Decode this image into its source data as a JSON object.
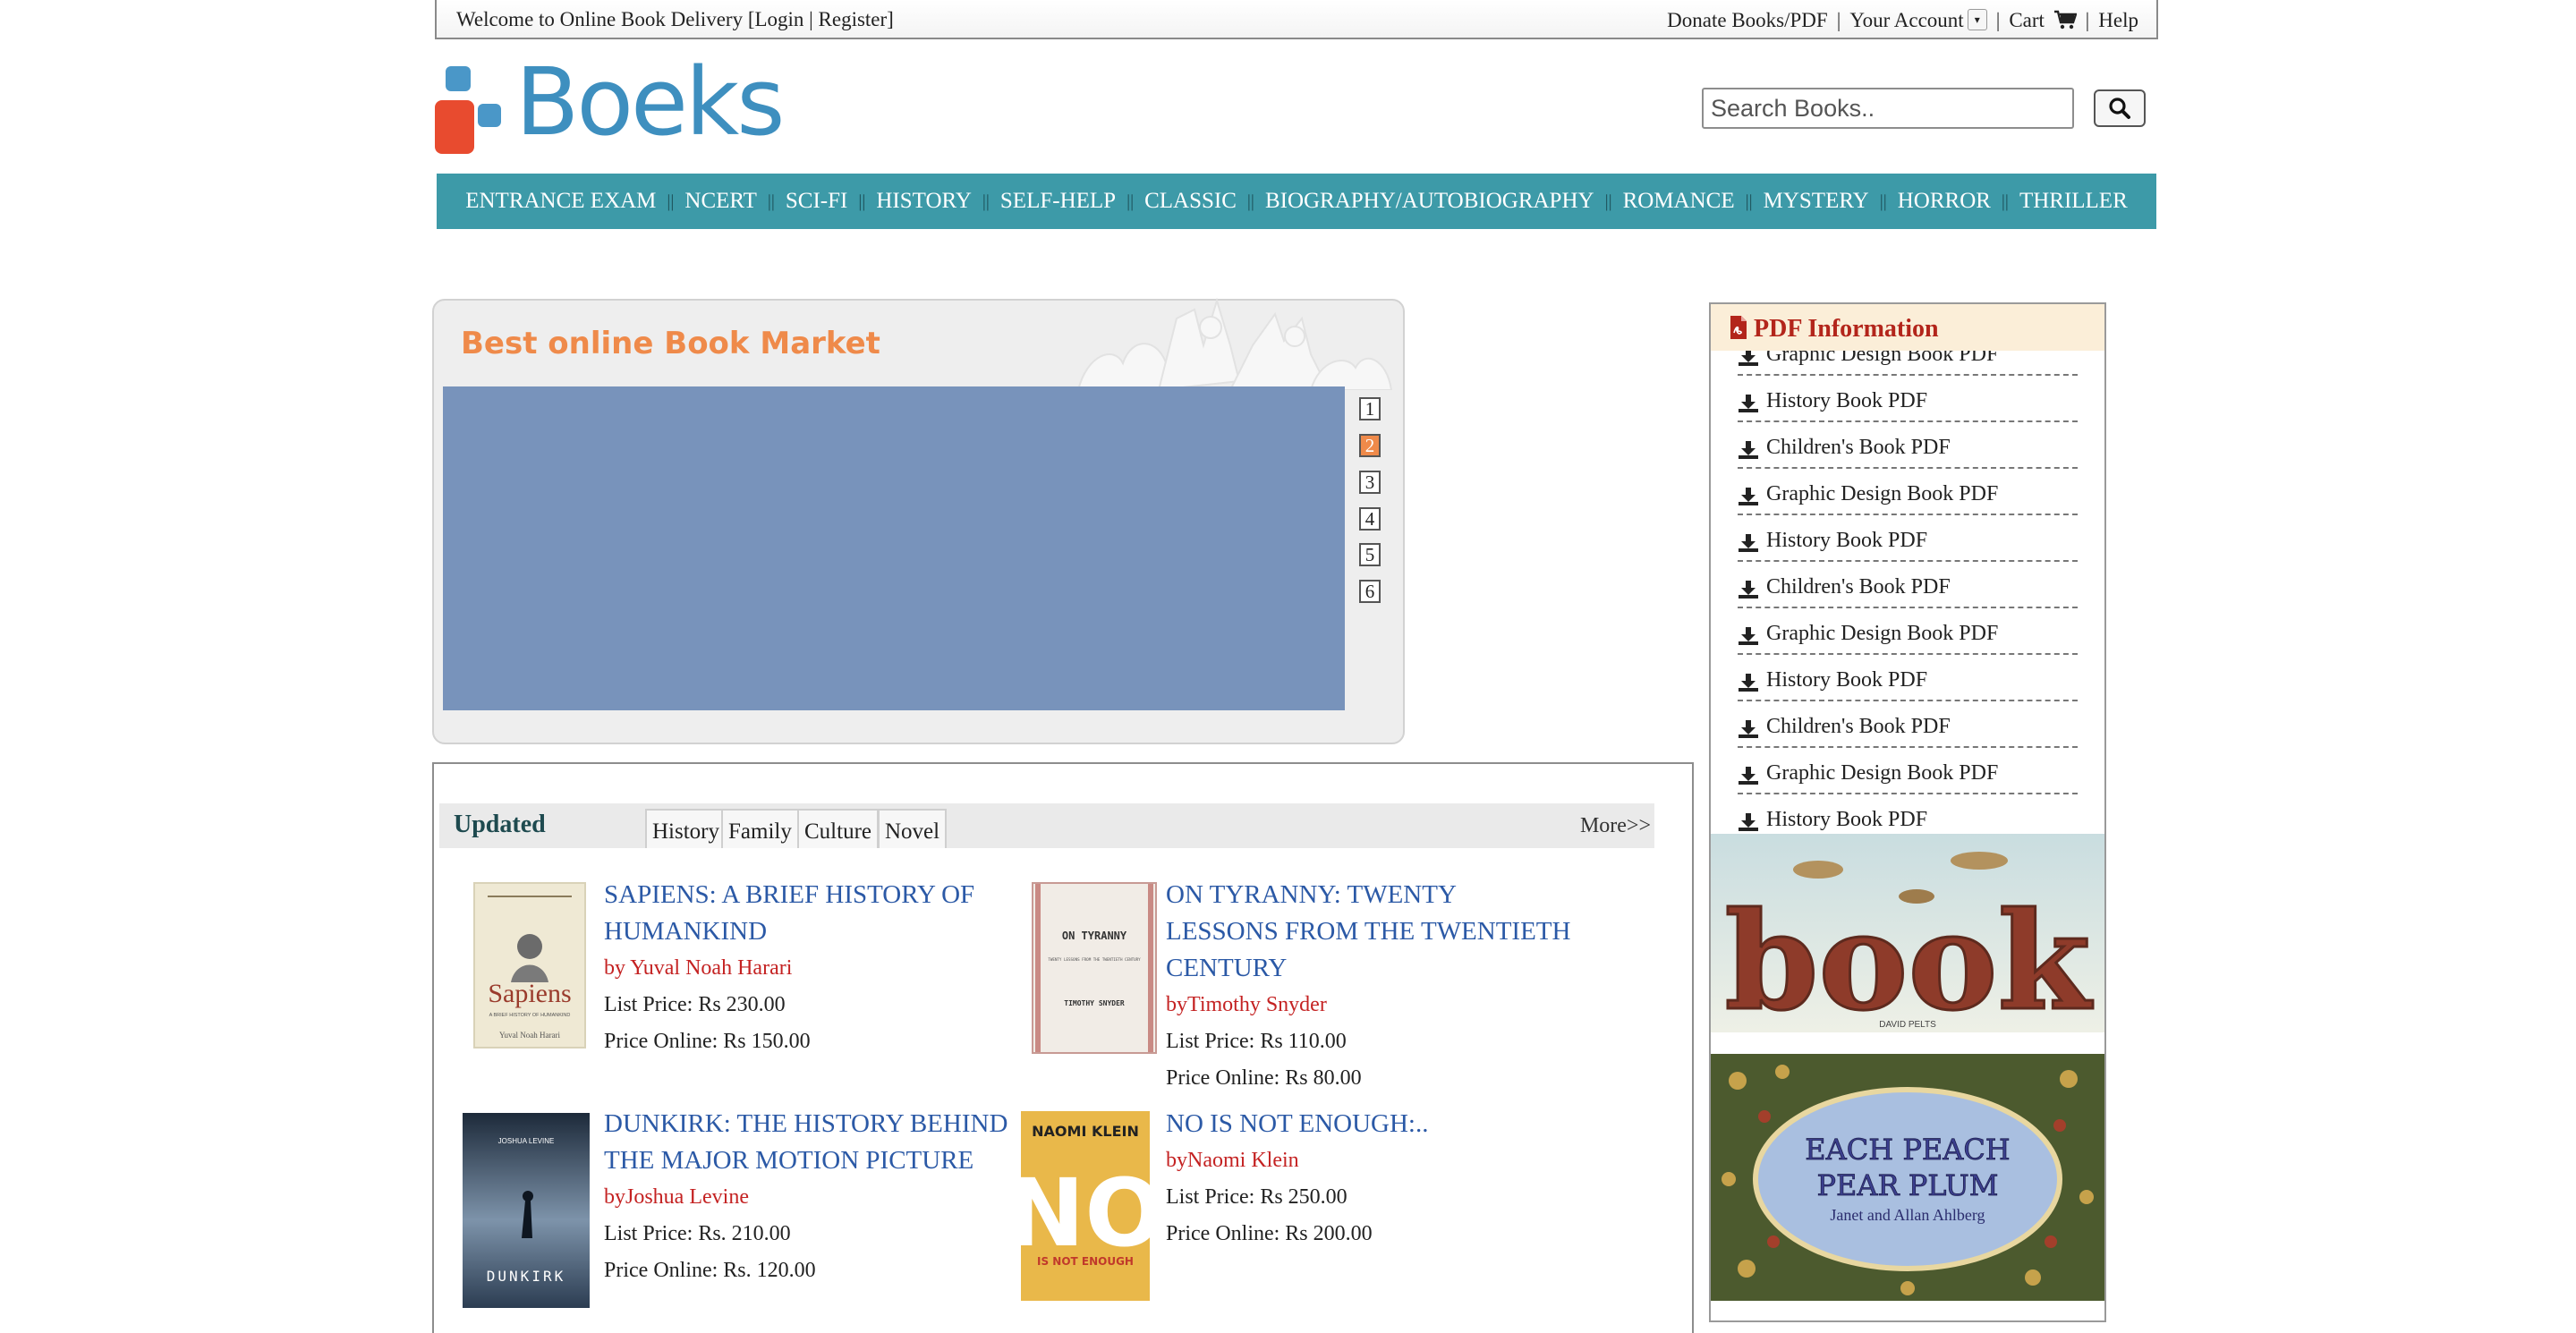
{
  "topbar": {
    "welcome": "Welcome to Online Book Delivery [Login | Register]",
    "donate": "Donate Books/PDF",
    "account": "Your Account",
    "cart": "Cart",
    "help": "Help",
    "separator": "|"
  },
  "brand": {
    "name": "Boeks",
    "colors": {
      "red": "#e84b2f",
      "blue": "#3e8fbf",
      "teal": "#3d9aa8",
      "orange": "#ef8a4a"
    }
  },
  "search": {
    "placeholder": "Search Books.."
  },
  "nav": {
    "separator": "||",
    "items": [
      "ENTRANCE EXAM",
      "NCERT",
      "SCI-FI",
      "HISTORY",
      "SELF-HELP",
      "CLASSIC",
      "BIOGRAPHY/AUTOBIOGRAPHY",
      "ROMANCE",
      "MYSTERY",
      "HORROR",
      "THRILLER"
    ]
  },
  "slider": {
    "title": "Best online Book Market",
    "pages": [
      "1",
      "2",
      "3",
      "4",
      "5",
      "6"
    ],
    "active_page": "2"
  },
  "updated": {
    "title": "Updated",
    "tabs": [
      "History",
      "Family",
      "Culture",
      "Novel"
    ],
    "more": "More>>",
    "books": [
      {
        "title_lines": [
          "SAPIENS: A BRIEF HISTORY OF",
          "HUMANKIND"
        ],
        "author": "by Yuval Noah Harari",
        "list_price": "List Price: Rs 230.00",
        "online_price": "Price Online: Rs 150.00",
        "cover": {
          "title": "Sapiens",
          "subtitle": "A BRIEF HISTORY OF HUMANKIND",
          "author": "Yuval Noah Harari",
          "bg": "#efe9d4"
        }
      },
      {
        "title_lines": [
          "ON TYRANNY: TWENTY",
          "LESSONS FROM THE TWENTIETH",
          "CENTURY"
        ],
        "author": "byTimothy Snyder",
        "list_price": "List Price: Rs 110.00",
        "online_price": "Price Online: Rs 80.00",
        "cover": {
          "title": "ON TYRANNY",
          "subtitle": "TWENTY LESSONS FROM THE TWENTIETH CENTURY",
          "author": "TIMOTHY SNYDER",
          "bg": "#f1ece6"
        }
      },
      {
        "title_lines": [
          "DUNKIRK: THE HISTORY BEHIND",
          "THE MAJOR MOTION PICTURE"
        ],
        "author": "byJoshua Levine",
        "list_price": "List Price: Rs. 210.00",
        "online_price": "Price Online: Rs. 120.00",
        "cover": {
          "title": "DUNKIRK",
          "author": "JOSHUA LEVINE",
          "bg": "#2a3c52"
        }
      },
      {
        "title_lines": [
          "NO IS NOT ENOUGH:.."
        ],
        "author": "byNaomi Klein",
        "list_price": "List Price: Rs 250.00",
        "online_price": "Price Online: Rs 200.00",
        "cover": {
          "title": "NO",
          "author": "NAOMI KLEIN",
          "subtitle": "IS NOT ENOUGH",
          "bg": "#e9b84a"
        }
      }
    ]
  },
  "sidebar": {
    "pdf_title": "PDF Information",
    "pdf_items": [
      "Graphic Design Book PDF",
      "History Book PDF",
      "Children's Book PDF",
      "Graphic Design Book PDF",
      "History Book PDF",
      "Children's Book PDF",
      "Graphic Design Book PDF",
      "History Book PDF",
      "Children's Book PDF",
      "Graphic Design Book PDF",
      "History Book PDF"
    ],
    "ad1": {
      "title": "book",
      "author": "DAVID PELTS"
    },
    "ad2": {
      "title_lines": [
        "EACH PEACH",
        "PEAR PLUM"
      ],
      "author": "Janet and Allan Ahlberg"
    }
  }
}
